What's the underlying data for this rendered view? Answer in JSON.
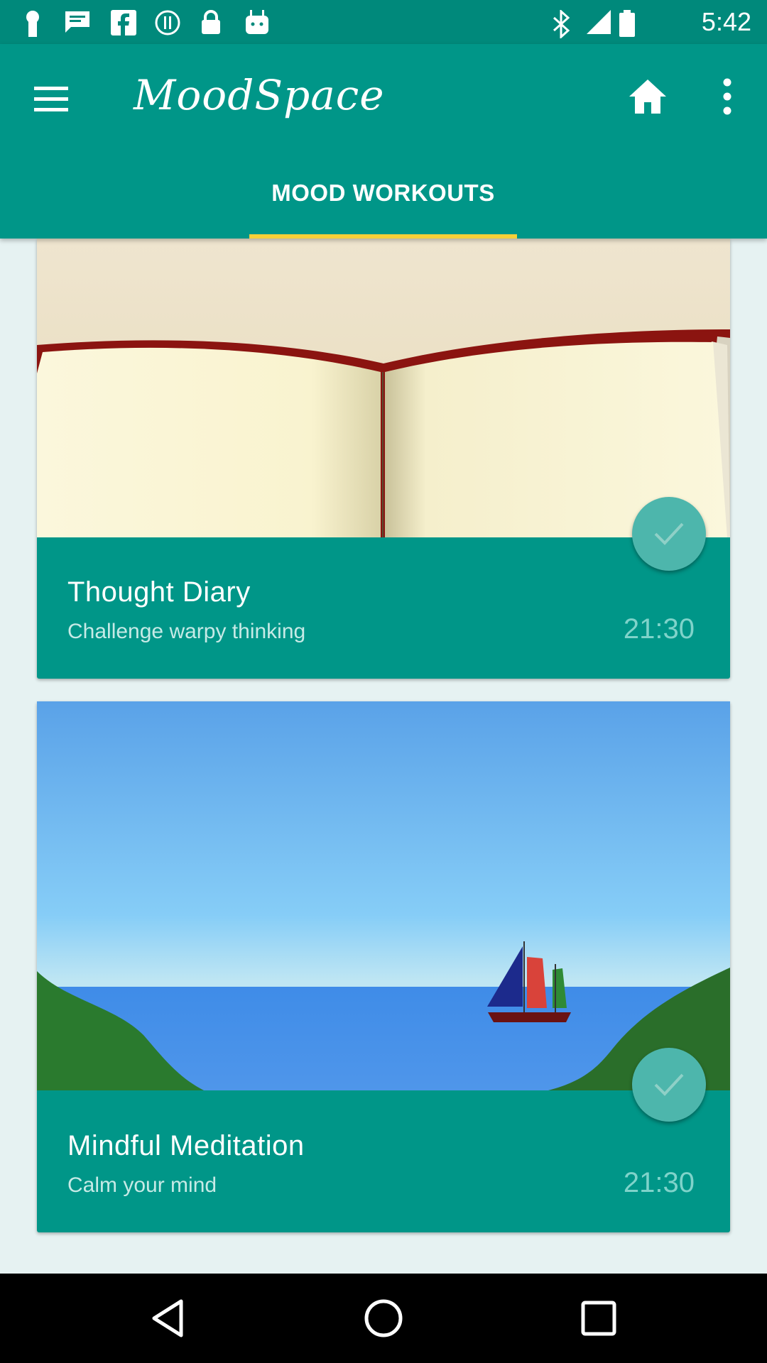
{
  "status_bar": {
    "time": "5:42"
  },
  "app_bar": {
    "title": "MoodSpace",
    "tab_label": "MOOD WORKOUTS"
  },
  "cards": [
    {
      "title": "Thought Diary",
      "subtitle": "Challenge warpy thinking",
      "duration": "21:30",
      "completed": false
    },
    {
      "title": "Mindful Meditation",
      "subtitle": "Calm your mind",
      "duration": "21:30",
      "completed": false
    }
  ],
  "icons": {
    "menu": "menu-icon",
    "home": "home-icon",
    "more": "more-vert-icon",
    "check": "check-icon",
    "nav_back": "back-triangle-icon",
    "nav_home": "home-circle-icon",
    "nav_recents": "recents-square-icon"
  },
  "colors": {
    "primary": "#009688",
    "status_bar": "#00897b",
    "tab_indicator": "#f7d038",
    "background": "#e6f2f2"
  }
}
